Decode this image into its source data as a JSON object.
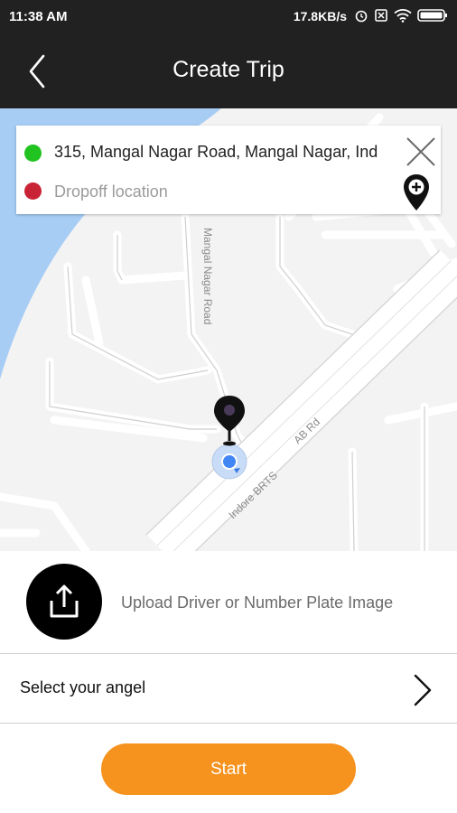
{
  "status_bar": {
    "time": "11:38 AM",
    "network_speed": "17.8KB/s",
    "icons": [
      "alarm-icon",
      "sim-blocked-icon",
      "wifi-icon",
      "battery-icon"
    ]
  },
  "header": {
    "title": "Create Trip",
    "back_icon": "back-arrow-icon",
    "background": "#212121"
  },
  "search": {
    "pickup_value": "315, Mangal Nagar Road, Mangal Nagar, Ind",
    "dropoff_placeholder": "Dropoff location",
    "pickup_color": "#21c321",
    "dropoff_color": "#c92435"
  },
  "map": {
    "street_labels": [
      "Mangal Nagar Road",
      "AB Rd",
      "Indore BRTS"
    ]
  },
  "upload": {
    "label": "Upload Driver or Number Plate Image",
    "icon": "upload-icon"
  },
  "angel": {
    "label": "Select your angel",
    "icon": "chevron-right-icon"
  },
  "start": {
    "label": "Start",
    "color": "#f6921e"
  }
}
